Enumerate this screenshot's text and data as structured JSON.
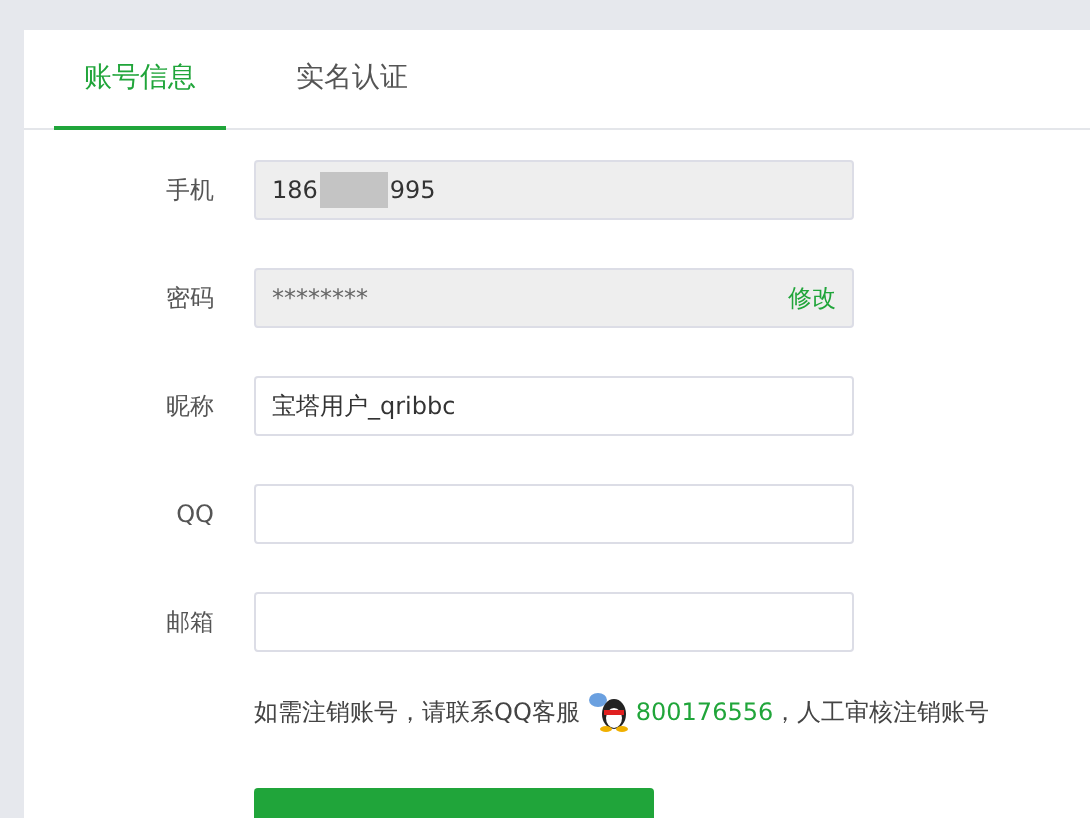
{
  "tabs": [
    {
      "label": "账号信息",
      "selected": true
    },
    {
      "label": "实名认证",
      "selected": false
    }
  ],
  "fields": [
    {
      "label": "手机",
      "kind": "masked",
      "prefix": "186",
      "suffix": "995",
      "disabled": true
    },
    {
      "label": "密码",
      "kind": "password",
      "value": "********",
      "action": "修改",
      "disabled": true
    },
    {
      "label": "昵称",
      "kind": "text",
      "value": "宝塔用户_qribbc",
      "disabled": false
    },
    {
      "label": "QQ",
      "kind": "text",
      "disabled": false
    },
    {
      "label": "邮箱",
      "kind": "text",
      "disabled": false
    }
  ],
  "notice": {
    "before": "如需注销账号，请联系QQ客服",
    "link": "800176556",
    "after": "，人工审核注销账号"
  }
}
